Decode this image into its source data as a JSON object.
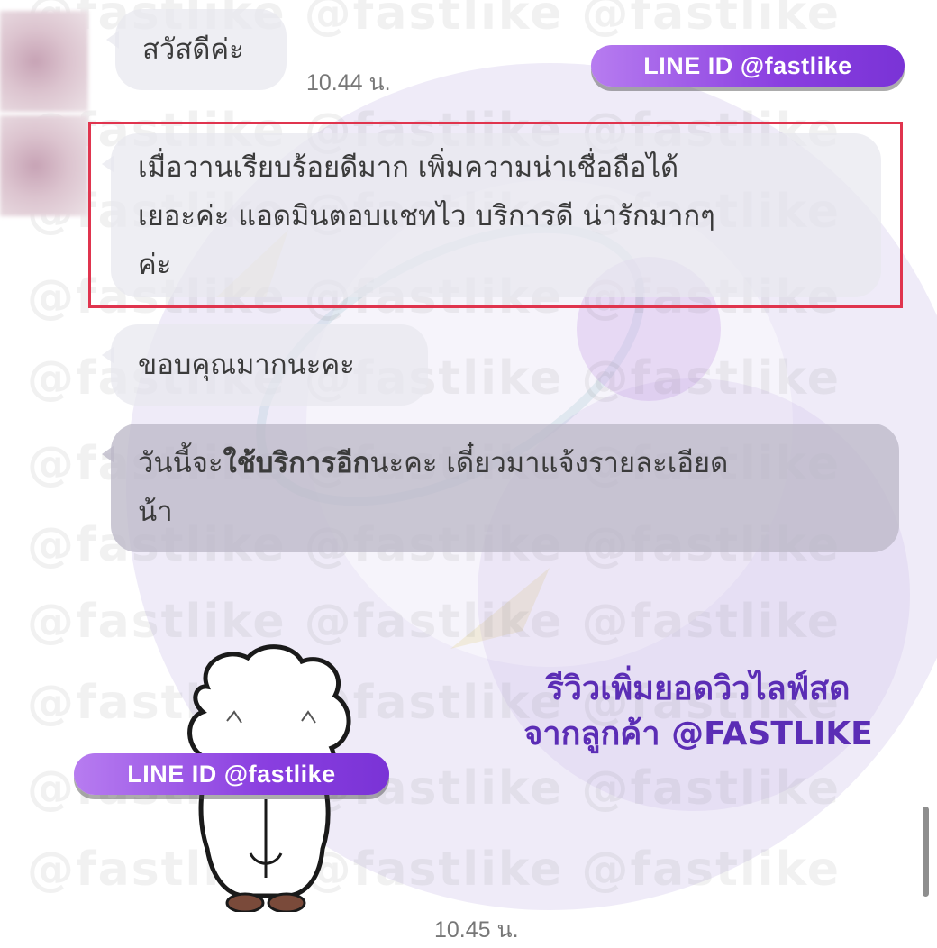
{
  "watermark": {
    "text": "@fastlike @fastlike @fastlike"
  },
  "line_badge": {
    "top": "LINE ID @fastlike",
    "bottom": "LINE ID @fastlike"
  },
  "messages": [
    {
      "text": "สวัสดีค่ะ"
    },
    {
      "lines": [
        "เมื่อวานเรียบร้อยดีมาก เพิ่มความน่าเชื่อถือได้",
        "เยอะค่ะ แอดมินตอบแชทไว บริการดี น่ารักมากๆ",
        "ค่ะ"
      ]
    },
    {
      "text": "ขอบคุณมากนะคะ"
    },
    {
      "part1": "วันนี้จะ",
      "part2_bold": "ใช้บริการอีก",
      "part3": "นะคะ เดี๋ยวมาแจ้งรายละเอียด",
      "line2": "น้า"
    }
  ],
  "times": {
    "first": "10.44 น.",
    "last": "10.45 น."
  },
  "caption": {
    "line1": "รีวิวเพิ่มยอดวิวไลฟ์สด",
    "line2": "จากลูกค้า @FASTLIKE"
  },
  "colors": {
    "highlight": "#e0344e",
    "badge": "#8a3fe0",
    "caption": "#5b2db5",
    "bubble": "#e8e8ee"
  }
}
